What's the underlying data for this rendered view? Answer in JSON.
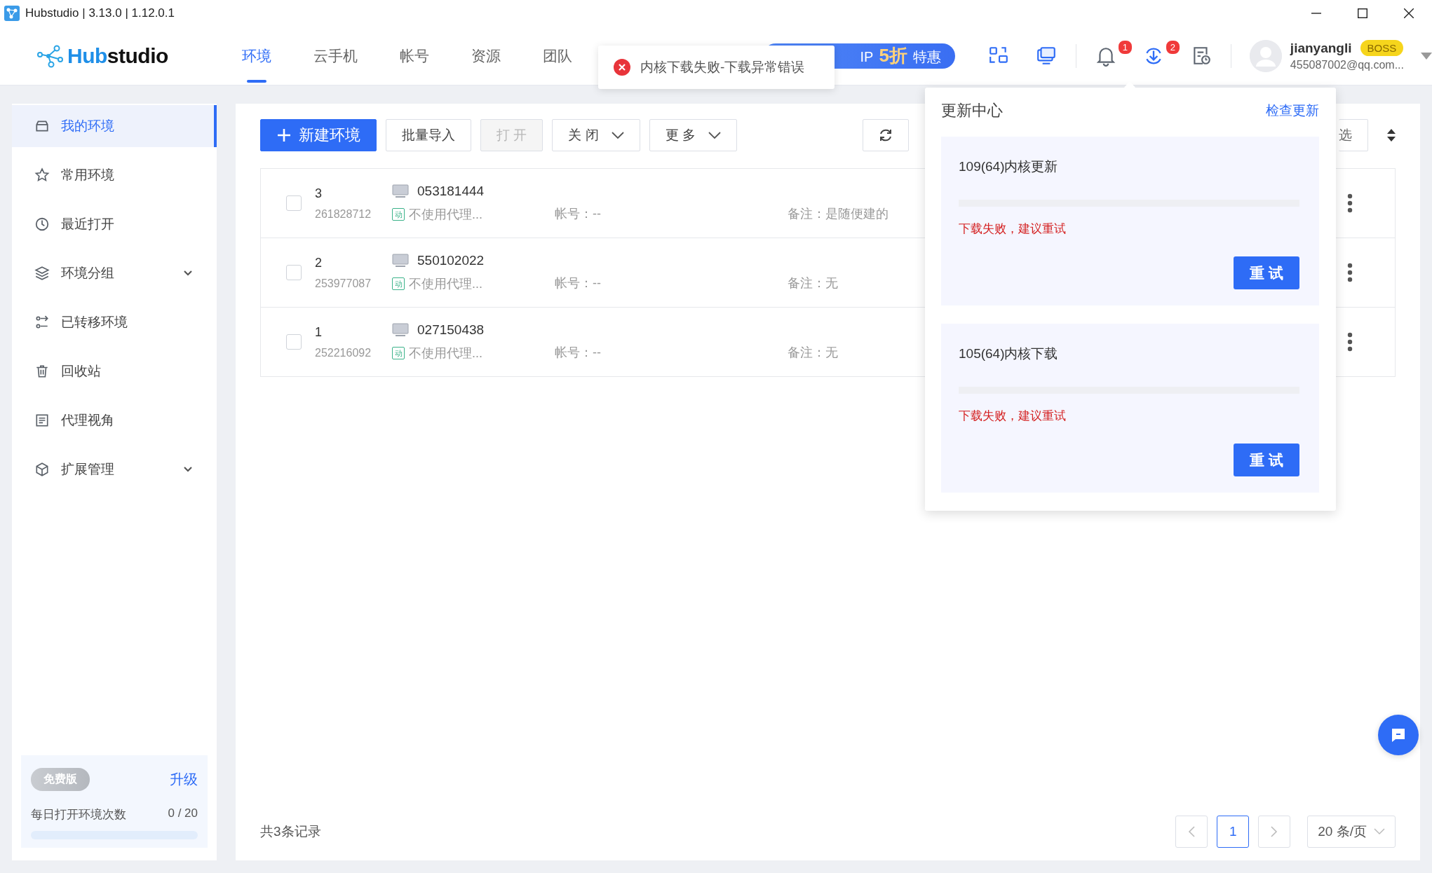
{
  "window": {
    "title": "Hubstudio | 3.13.0 | 1.12.0.1"
  },
  "logo": {
    "accent": "Hub",
    "rest": "studio"
  },
  "nav_tabs": [
    {
      "label": "环境",
      "selected": true
    },
    {
      "label": "云手机",
      "selected": false
    },
    {
      "label": "帐号",
      "selected": false
    },
    {
      "label": "资源",
      "selected": false
    },
    {
      "label": "团队",
      "selected": false
    }
  ],
  "promo": {
    "prefix": "IP",
    "discount": "5折",
    "suffix": "特惠"
  },
  "toast": {
    "kind": "error",
    "message": "内核下载失败-下载异常错误"
  },
  "header_tools": [
    {
      "kind": "devices"
    },
    {
      "kind": "screens"
    },
    {
      "kind": "bell",
      "badge": "1",
      "selected": false
    },
    {
      "kind": "download",
      "badge": "2",
      "selected": true
    },
    {
      "kind": "schedule",
      "selected": false
    }
  ],
  "user": {
    "name": "jianyangli",
    "role": "BOSS",
    "email": "455087002@qq.com..."
  },
  "sidebar": {
    "items": [
      {
        "label": "我的环境",
        "kind": "item",
        "selected": true
      },
      {
        "label": "常用环境",
        "kind": "item",
        "selected": false
      },
      {
        "label": "最近打开",
        "kind": "item",
        "selected": false
      },
      {
        "label": "环境分组",
        "kind": "group",
        "selected": false
      },
      {
        "label": "已转移环境",
        "kind": "item",
        "selected": false
      },
      {
        "label": "回收站",
        "kind": "item",
        "selected": false
      },
      {
        "label": "代理视角",
        "kind": "item",
        "selected": false
      },
      {
        "label": "扩展管理",
        "kind": "group",
        "selected": false
      }
    ],
    "plan": {
      "name": "免费版",
      "upgrade": "升级",
      "quota_label": "每日打开环境次数",
      "quota_value": "0 / 20",
      "level": 0
    }
  },
  "toolbar": {
    "buttons": [
      {
        "label": "新建环境",
        "kind": "primary",
        "disabled": false
      },
      {
        "label": "批量导入",
        "kind": "default",
        "disabled": false
      },
      {
        "label": "打 开",
        "kind": "default",
        "disabled": true
      },
      {
        "label": "关 闭",
        "kind": "dropdown",
        "disabled": false
      },
      {
        "label": "更 多",
        "kind": "dropdown",
        "disabled": false
      }
    ],
    "filter": "选"
  },
  "table": {
    "rows": [
      {
        "seq": "3",
        "serial": "261828712",
        "name": "053181444",
        "proxy_tag": "动",
        "proxy": "不使用代理...",
        "account": "帐号：--",
        "remark": "备注：是随便建的",
        "checked": false
      },
      {
        "seq": "2",
        "serial": "253977087",
        "name": "550102022",
        "proxy_tag": "动",
        "proxy": "不使用代理...",
        "account": "帐号：--",
        "remark": "备注：无",
        "checked": false
      },
      {
        "seq": "1",
        "serial": "252216092",
        "name": "027150438",
        "proxy_tag": "动",
        "proxy": "不使用代理...",
        "account": "帐号：--",
        "remark": "备注：无",
        "checked": false
      }
    ]
  },
  "footer": {
    "total": "共3条记录",
    "pages": [
      {
        "label": "1",
        "selected": true
      }
    ],
    "page_size": "20 条/页"
  },
  "update_center": {
    "title": "更新中心",
    "action": "检查更新",
    "items": [
      {
        "title": "109(64)内核更新",
        "level": 0,
        "status": "下载失败，建议重试",
        "button": "重 试"
      },
      {
        "title": "105(64)内核下载",
        "level": 0,
        "status": "下载失败，建议重试",
        "button": "重 试"
      }
    ]
  }
}
